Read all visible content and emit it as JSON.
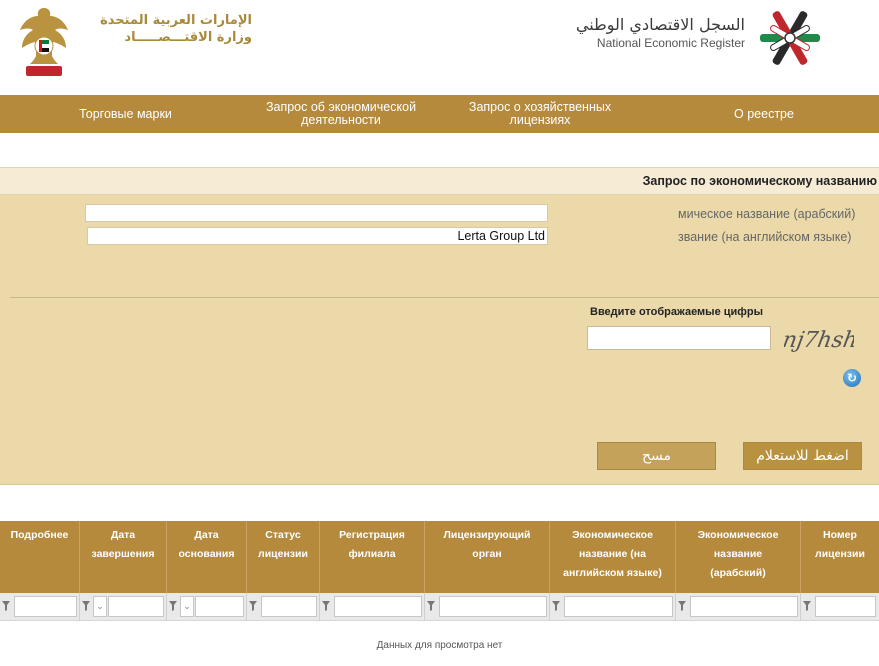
{
  "header": {
    "uae_line1": "الإمارات العربية المتحدة",
    "uae_line2": "وزارة الاقتـــصـــــاد",
    "ner_ar": "السجل الاقتصادي الوطني",
    "ner_en": "National Economic Register"
  },
  "nav": {
    "items": [
      {
        "label": "Торговые марки"
      },
      {
        "label": "Запрос об экономической\nдеятельности"
      },
      {
        "label": "Запрос о хозяйственных\nлицензиях"
      },
      {
        "label": "О реестре"
      }
    ]
  },
  "section": {
    "title": "Запрос по экономическому названию"
  },
  "form": {
    "arabic_label": "мическое название (арабский)",
    "arabic_value": "",
    "english_label": "звание (на английском языке)",
    "english_value": "Lerta Group Ltd",
    "captcha_label": "Введите отображаемые цифры",
    "captcha_value": "",
    "captcha_text": "nj7hsh",
    "clear_button": "مسح",
    "submit_button": "اضغط للاستعلام"
  },
  "grid": {
    "columns": [
      {
        "label": "Подробнее"
      },
      {
        "label": "Дата\nзавершения"
      },
      {
        "label": "Дата\nоснования"
      },
      {
        "label": "Статус\nлицензии"
      },
      {
        "label": "Регистрация\nфилиала"
      },
      {
        "label": "Лицензирующий\nорган"
      },
      {
        "label": "Экономическое\nназвание (на\nанглийском языке)"
      },
      {
        "label": "Экономическое\nназвание\n(арабский)"
      },
      {
        "label": "Номер\nлицензии"
      }
    ],
    "empty_message": "Данных для просмотра нет"
  },
  "colors": {
    "brand": "#b58a3c",
    "panel": "#ebd9a9",
    "title_bar": "#f6ecd6"
  }
}
